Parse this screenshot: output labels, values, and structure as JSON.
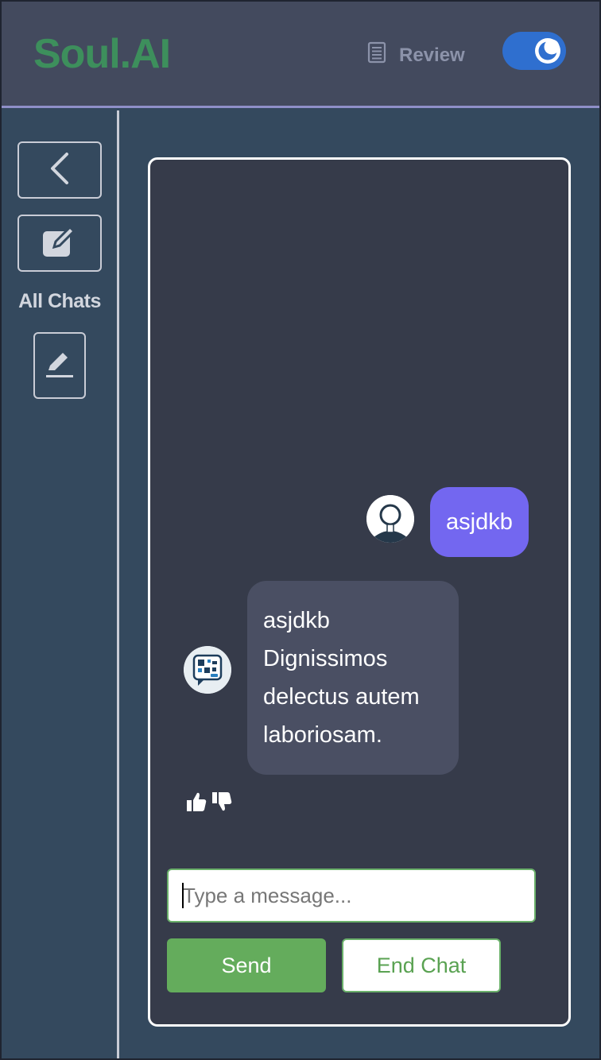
{
  "header": {
    "logo": "Soul.AI",
    "review_label": "Review",
    "review_icon": "document-icon",
    "theme_toggle_icon": "moon-icon"
  },
  "sidebar": {
    "back_icon": "chevron-left-icon",
    "new_chat_icon": "edit-square-icon",
    "all_chats_label": "All Chats",
    "edit_icon": "pencil-underline-icon"
  },
  "chat": {
    "messages": [
      {
        "role": "user",
        "text": "asjdkb",
        "avatar": "user-avatar-icon"
      },
      {
        "role": "bot",
        "text": "asjdkb Dignissimos delectus autem laboriosam.",
        "avatar": "bot-avatar-icon"
      }
    ],
    "feedback": {
      "like_icon": "thumbs-up-icon",
      "dislike_icon": "thumbs-down-icon"
    },
    "input": {
      "placeholder": "Type a message...",
      "value": ""
    },
    "send_label": "Send",
    "end_chat_label": "End Chat"
  },
  "colors": {
    "brand": "#3d8f5c",
    "header_bg": "#434a5e",
    "page_bg": "#34495e",
    "chat_bg": "#363b4a",
    "user_bubble": "#7367f0",
    "bot_bubble": "#4a4f63",
    "send_button": "#64ac5c",
    "toggle": "#2f6fcf"
  }
}
